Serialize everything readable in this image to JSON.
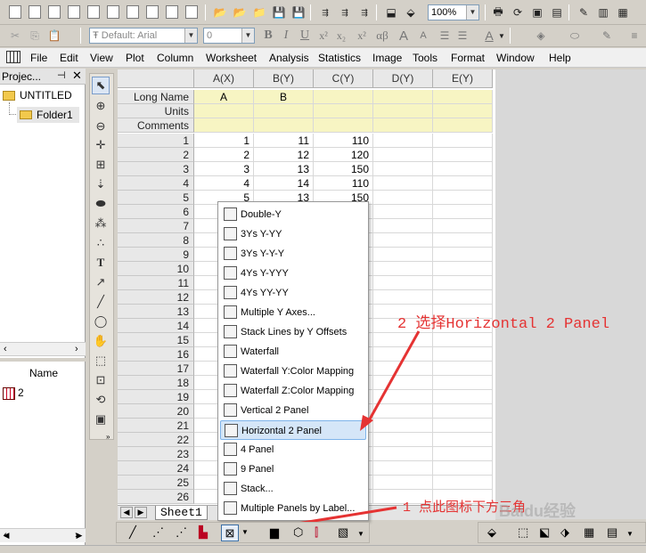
{
  "toolbar": {
    "font_combo": "Default: Arial",
    "size_combo": "0",
    "zoom_combo": "100%",
    "bold": "B",
    "italic": "I",
    "underline": "U",
    "superscript": "x²",
    "subscript": "x₂",
    "superscript2": "x²",
    "greek": "αβ",
    "grow_font": "A",
    "shrink_font": "A"
  },
  "menubar": {
    "file": "File",
    "edit": "Edit",
    "view": "View",
    "plot": "Plot",
    "column": "Column",
    "worksheet": "Worksheet",
    "analysis": "Analysis",
    "statistics": "Statistics",
    "image": "Image",
    "tools": "Tools",
    "format": "Format",
    "window": "Window",
    "help": "Help"
  },
  "project": {
    "title": "Projec...",
    "untitled": "UNTITLED",
    "folder": "Folder1",
    "name_header": "Name",
    "item": "2"
  },
  "sheet": {
    "columns": [
      "A(X)",
      "B(Y)",
      "C(Y)",
      "D(Y)",
      "E(Y)"
    ],
    "row_labels_meta": [
      "Long Name",
      "Units",
      "Comments"
    ],
    "long_names": [
      "A",
      "B",
      "",
      "",
      ""
    ],
    "rows": [
      {
        "n": "1",
        "a": "1",
        "b": "11",
        "c": "110"
      },
      {
        "n": "2",
        "a": "2",
        "b": "12",
        "c": "120"
      },
      {
        "n": "3",
        "a": "3",
        "b": "13",
        "c": "150"
      },
      {
        "n": "4",
        "a": "4",
        "b": "14",
        "c": "110"
      },
      {
        "n": "5",
        "a": "5",
        "b": "13",
        "c": "150"
      },
      {
        "n": "6",
        "a": "",
        "b": "",
        "c": ""
      },
      {
        "n": "7",
        "a": "",
        "b": "",
        "c": ""
      },
      {
        "n": "8",
        "a": "",
        "b": "",
        "c": ""
      },
      {
        "n": "9",
        "a": "",
        "b": "",
        "c": ""
      },
      {
        "n": "10",
        "a": "",
        "b": "",
        "c": ""
      },
      {
        "n": "11",
        "a": "",
        "b": "",
        "c": ""
      },
      {
        "n": "12",
        "a": "",
        "b": "",
        "c": ""
      },
      {
        "n": "13",
        "a": "",
        "b": "",
        "c": ""
      },
      {
        "n": "14",
        "a": "",
        "b": "",
        "c": ""
      },
      {
        "n": "15",
        "a": "",
        "b": "",
        "c": ""
      },
      {
        "n": "16",
        "a": "",
        "b": "",
        "c": ""
      },
      {
        "n": "17",
        "a": "",
        "b": "",
        "c": ""
      },
      {
        "n": "18",
        "a": "",
        "b": "",
        "c": ""
      },
      {
        "n": "19",
        "a": "",
        "b": "",
        "c": ""
      },
      {
        "n": "20",
        "a": "",
        "b": "",
        "c": ""
      },
      {
        "n": "21",
        "a": "",
        "b": "",
        "c": ""
      },
      {
        "n": "22",
        "a": "",
        "b": "",
        "c": ""
      },
      {
        "n": "23",
        "a": "",
        "b": "",
        "c": ""
      },
      {
        "n": "24",
        "a": "",
        "b": "",
        "c": ""
      },
      {
        "n": "25",
        "a": "",
        "b": "",
        "c": ""
      },
      {
        "n": "26",
        "a": "",
        "b": "",
        "c": ""
      }
    ],
    "tab": "Sheet1"
  },
  "context_menu": {
    "items": [
      "Double-Y",
      "3Ys Y-YY",
      "3Ys Y-Y-Y",
      "4Ys Y-YYY",
      "4Ys YY-YY",
      "Multiple Y Axes...",
      "Stack Lines by Y Offsets",
      "Waterfall",
      "Waterfall Y:Color Mapping",
      "Waterfall Z:Color Mapping",
      "Vertical 2 Panel",
      "Horizontal 2 Panel",
      "4 Panel",
      "9 Panel",
      "Stack...",
      "Multiple Panels by Label..."
    ],
    "highlighted_index": 11
  },
  "annotations": {
    "step2": "2 选择Horizontal 2 Panel",
    "step1": "1 点此图标下方三角",
    "color": "#e53333"
  },
  "watermark": "Baidu经验",
  "status_bar": ""
}
